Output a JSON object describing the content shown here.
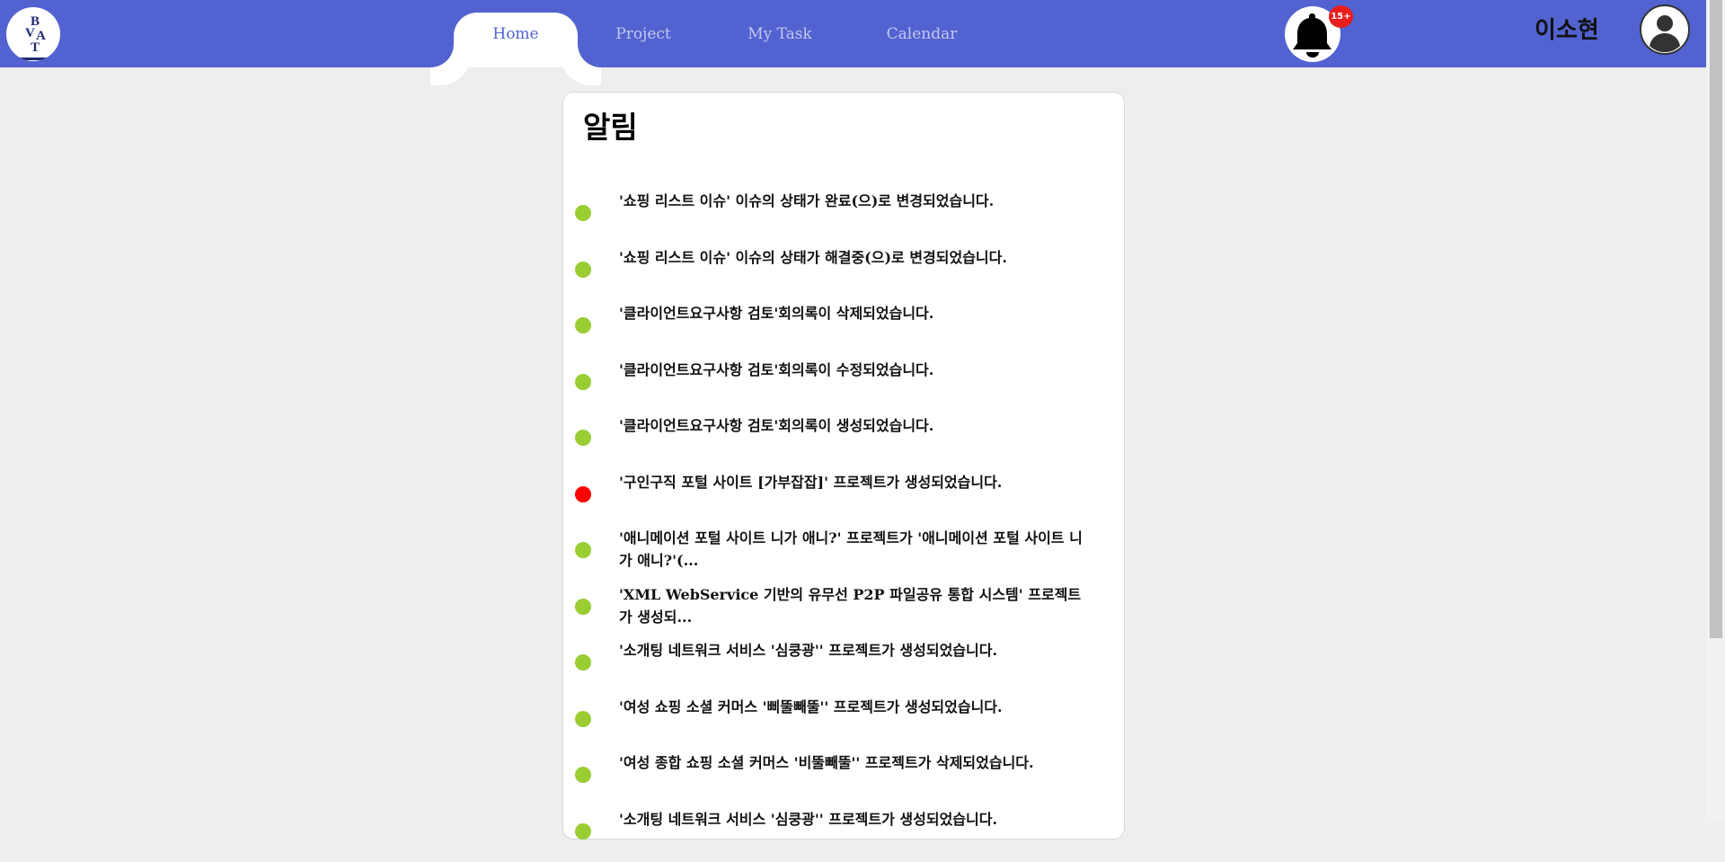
{
  "header": {
    "logo_letters": [
      "B",
      "V",
      "A",
      "T"
    ],
    "nav_tabs": [
      {
        "label": "Home",
        "active": true
      },
      {
        "label": "Project",
        "active": false
      },
      {
        "label": "My Task",
        "active": false
      },
      {
        "label": "Calendar",
        "active": false
      }
    ],
    "notification_badge": "15+",
    "user_name": "이소현",
    "icons": {
      "bell": "bell-icon",
      "avatar": "user-avatar-icon"
    }
  },
  "notifications": {
    "title": "알림",
    "items": [
      {
        "text": "'쇼핑 리스트 이슈' 이슈의 상태가 완료(으)로 변경되었습니다.",
        "status_color": "#9acd32"
      },
      {
        "text": "'쇼핑 리스트 이슈' 이슈의 상태가 해결중(으)로 변경되었습니다.",
        "status_color": "#9acd32"
      },
      {
        "text": "'클라이언트요구사항 검토'회의록이 삭제되었습니다.",
        "status_color": "#9acd32"
      },
      {
        "text": "'클라이언트요구사항 검토'회의록이 수정되었습니다.",
        "status_color": "#9acd32"
      },
      {
        "text": "'클라이언트요구사항 검토'회의록이 생성되었습니다.",
        "status_color": "#9acd32"
      },
      {
        "text": "'구인구직 포털 사이트 [가부잡잡]' 프로젝트가 생성되었습니다.",
        "status_color": "#ff0000"
      },
      {
        "text": "'애니메이션 포털 사이트 니가 애니?' 프로젝트가 '애니메이션 포털 사이트 니가 애니?'(...",
        "status_color": "#9acd32"
      },
      {
        "text": "'XML WebService 기반의 유무선 P2P 파일공유 통합 시스템' 프로젝트가 생성되...",
        "status_color": "#9acd32"
      },
      {
        "text": "'소개팅 네트워크 서비스 '심쿵광'' 프로젝트가 생성되었습니다.",
        "status_color": "#9acd32"
      },
      {
        "text": "'여성 쇼핑 소셜 커머스 '삐뚤빼뚤'' 프로젝트가 생성되었습니다.",
        "status_color": "#9acd32"
      },
      {
        "text": "'여성 종합 쇼핑 소셜 커머스 '비뚤빼뚤'' 프로젝트가 삭제되었습니다.",
        "status_color": "#9acd32"
      },
      {
        "text": "'소개팅 네트워크 서비스 '심쿵광'' 프로젝트가 생성되었습니다.",
        "status_color": "#9acd32"
      }
    ]
  },
  "colors": {
    "header_bg": "#5262d0",
    "page_bg": "#eeeeee",
    "badge": "#ea1d1d",
    "read_dot": "#9acd32",
    "unread_dot": "#ff0000"
  }
}
